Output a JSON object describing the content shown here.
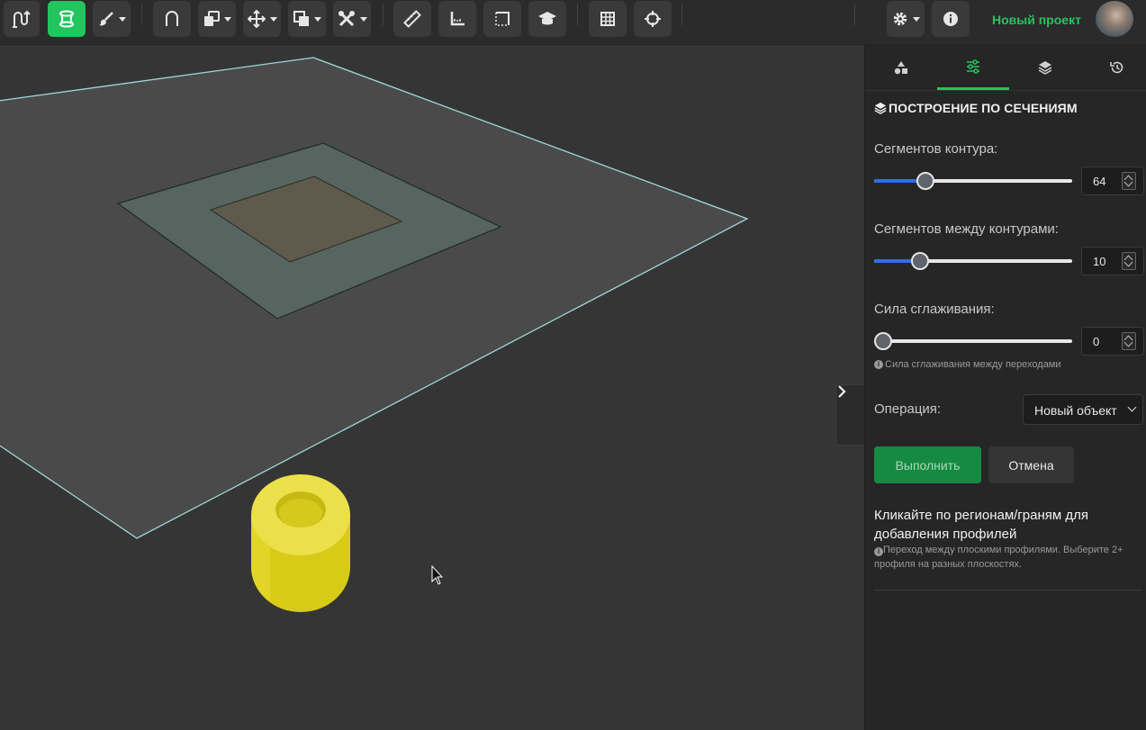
{
  "toolbar": {
    "tools": [
      {
        "icon": "sketch-to-extrude-icon"
      },
      {
        "icon": "loft-icon",
        "active": true
      },
      {
        "icon": "brush-icon"
      },
      {
        "icon": "arch-icon"
      },
      {
        "icon": "copy-shape-icon"
      },
      {
        "icon": "move-icon"
      },
      {
        "icon": "boolean-icon"
      },
      {
        "icon": "tools-icon"
      },
      {
        "icon": "ruler-icon"
      },
      {
        "icon": "angle-measure-icon"
      },
      {
        "icon": "bounding-box-icon"
      },
      {
        "icon": "tutorial-icon"
      },
      {
        "icon": "grid-icon"
      },
      {
        "icon": "crosshair-icon"
      },
      {
        "icon": "gear-icon"
      },
      {
        "icon": "info-icon"
      }
    ],
    "project_name": "Новый проект",
    "accent_color": "#22c55e"
  },
  "panel": {
    "tabs": [
      {
        "icon": "shapes-icon"
      },
      {
        "icon": "sliders-icon",
        "active": true
      },
      {
        "icon": "layers-icon"
      },
      {
        "icon": "history-icon"
      }
    ],
    "title": "ПОСТРОЕНИЕ ПО СЕЧЕНИЯМ",
    "fields": {
      "contour_segments": {
        "label": "Сегментов контура:",
        "value": "64",
        "fraction": 0.26
      },
      "between_segments": {
        "label": "Сегментов между контурами:",
        "value": "10",
        "fraction": 0.23
      },
      "smoothing": {
        "label": "Сила сглаживания:",
        "value": "0",
        "fraction": 0.0,
        "hint": "Сила сглаживания между переходами"
      }
    },
    "operation": {
      "label": "Операция:",
      "selected": "Новый объект"
    },
    "run_label": "Выполнить",
    "cancel_label": "Отмена",
    "click_hint": "Кликайте по регионам/граням для добавления профилей",
    "click_sub": "Переход между плоскими профилями. Выберите 2+ профиля на разных плоскостях."
  },
  "viewport": {
    "plane_color": "#4a4a4a",
    "plane_edge_color": "#9fd8d8",
    "outer_square_color": "#56655f",
    "inner_square_color": "#5e5a4c",
    "cylinder_color": "#e0d21f"
  }
}
